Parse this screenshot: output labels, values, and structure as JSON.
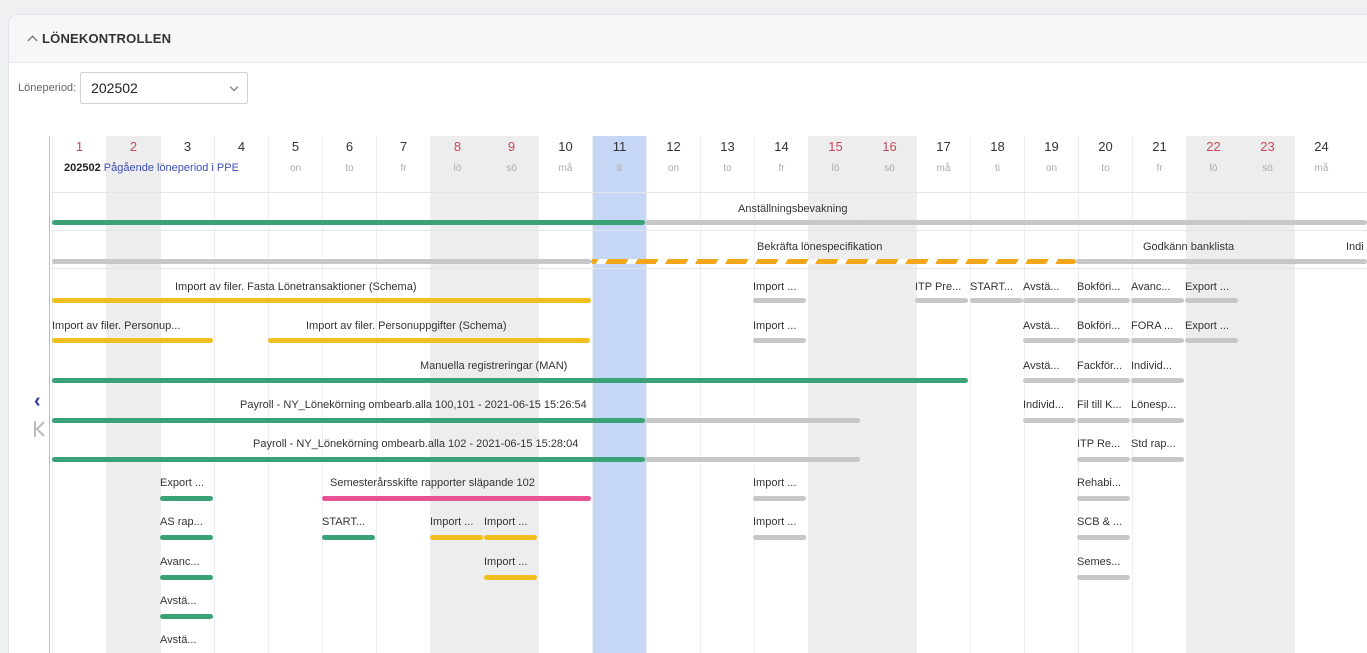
{
  "panel": {
    "title": "LÖNEKONTROLLEN"
  },
  "period": {
    "label": "Löneperiod:",
    "value": "202502"
  },
  "period_info": {
    "id": "202502",
    "text": "Pågående löneperiod i PPE"
  },
  "days": [
    {
      "n": "1",
      "d": "",
      "red": true,
      "we": false
    },
    {
      "n": "2",
      "d": "",
      "red": true,
      "we": true
    },
    {
      "n": "3",
      "d": "",
      "red": false,
      "we": false
    },
    {
      "n": "4",
      "d": "",
      "red": false,
      "we": false
    },
    {
      "n": "5",
      "d": "on",
      "red": false,
      "we": false
    },
    {
      "n": "6",
      "d": "to",
      "red": false,
      "we": false
    },
    {
      "n": "7",
      "d": "fr",
      "red": false,
      "we": false
    },
    {
      "n": "8",
      "d": "lö",
      "red": true,
      "we": true
    },
    {
      "n": "9",
      "d": "sö",
      "red": true,
      "we": true
    },
    {
      "n": "10",
      "d": "må",
      "red": false,
      "we": false
    },
    {
      "n": "11",
      "d": "ti",
      "red": false,
      "we": false,
      "today": true
    },
    {
      "n": "12",
      "d": "on",
      "red": false,
      "we": false
    },
    {
      "n": "13",
      "d": "to",
      "red": false,
      "we": false
    },
    {
      "n": "14",
      "d": "fr",
      "red": false,
      "we": false
    },
    {
      "n": "15",
      "d": "lö",
      "red": true,
      "we": true
    },
    {
      "n": "16",
      "d": "sö",
      "red": true,
      "we": true
    },
    {
      "n": "17",
      "d": "må",
      "red": false,
      "we": false
    },
    {
      "n": "18",
      "d": "ti",
      "red": false,
      "we": false
    },
    {
      "n": "19",
      "d": "on",
      "red": false,
      "we": false
    },
    {
      "n": "20",
      "d": "to",
      "red": false,
      "we": false
    },
    {
      "n": "21",
      "d": "fr",
      "red": false,
      "we": false
    },
    {
      "n": "22",
      "d": "lö",
      "red": true,
      "we": true
    },
    {
      "n": "23",
      "d": "sö",
      "red": true,
      "we": true
    },
    {
      "n": "24",
      "d": "må",
      "red": false,
      "we": false
    }
  ],
  "tasks": {
    "anstallning": "Anställningsbevakning",
    "bekrafta": "Bekräfta lönespecifikation",
    "godkann": "Godkänn banklista",
    "indi": "Indi",
    "import_fasta": "Import av filer. Fasta Lönetransaktioner (Schema)",
    "import_personup": "Import av filer. Personup...",
    "import_personuppgifter": "Import av filer. Personuppgifter (Schema)",
    "manuella": "Manuella registreringar (MAN)",
    "payroll1": "Payroll - NY_Lönekörning ombearb.alla 100,101 - 2021-06-15 15:26:54",
    "payroll2": "Payroll - NY_Lönekörning ombearb.alla 102 - 2021-06-15 15:28:04",
    "semester": "Semesterårsskifte rapporter släpande 102",
    "export1": "Export ...",
    "as_rap": "AS rap...",
    "avanc1": "Avanc...",
    "avsta_a": "Avstä...",
    "avsta_b": "Avstä...",
    "start1": "START...",
    "import_a": "Import ...",
    "import_b": "Import ...",
    "import_c": "Import ...",
    "import_14a": "Import ...",
    "import_14b": "Import ...",
    "import_14c": "Import ...",
    "import_14d": "Import ...",
    "itp_pre": "ITP Pre...",
    "start2": "START...",
    "avsta_1": "Avstä...",
    "bokfori_1": "Bokföri...",
    "avanc_2": "Avanc...",
    "export_2": "Export ...",
    "avsta_2": "Avstä...",
    "bokfori_2": "Bokföri...",
    "fora": "FORA ...",
    "export_3": "Export ...",
    "avsta_3": "Avstä...",
    "fackfor": "Fackför...",
    "individ_1": "Individ...",
    "individ_2": "Individ...",
    "fil_till": "Fil till K...",
    "lonesp": "Lönesp...",
    "itp_re": "ITP Re...",
    "std_rap": "Std rap...",
    "rehabi": "Rehabi...",
    "scb": "SCB & ...",
    "semes": "Semes..."
  },
  "colors": {
    "green": "#3aa276",
    "grey": "#c6c7c9",
    "yellow": "#f0be1e",
    "pink": "#e75294",
    "today": "#c5d7f5",
    "accent": "#3a4fb3"
  }
}
